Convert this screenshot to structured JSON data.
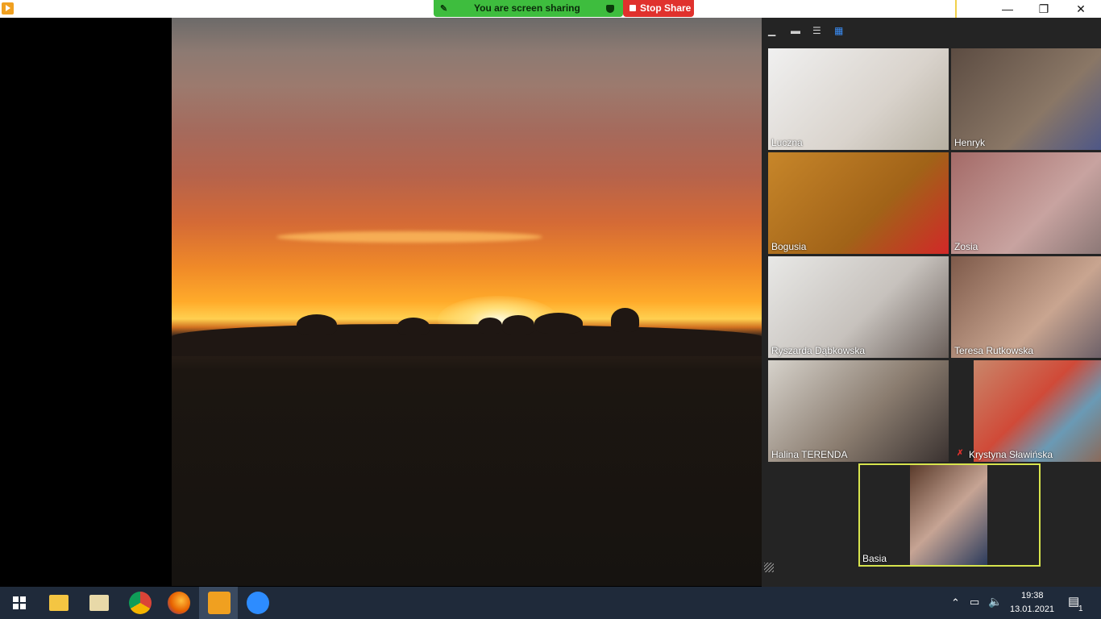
{
  "share_toolbar": {
    "status_text": "You are screen sharing",
    "stop_label": "Stop Share"
  },
  "window": {
    "minimize": "—",
    "maximize": "❐",
    "close": "✕"
  },
  "gallery": {
    "view_controls": [
      "minimize-view",
      "speaker-view",
      "gallery-strip",
      "gallery-view"
    ],
    "participants": [
      {
        "name": "Luczna"
      },
      {
        "name": "Henryk"
      },
      {
        "name": "Bogusia"
      },
      {
        "name": "Zosia"
      },
      {
        "name": "Ryszarda Dąbkowska"
      },
      {
        "name": "Teresa Rutkowska"
      },
      {
        "name": "Halina TERENDA"
      },
      {
        "name": "Krystyna Sławińska",
        "muted": true
      },
      {
        "name": "Basia",
        "active_speaker": true
      }
    ]
  },
  "taskbar": {
    "apps": [
      "windows-start",
      "file-explorer",
      "mail",
      "chrome",
      "firefox",
      "zoom-share",
      "zoom"
    ],
    "time": "19:38",
    "date": "13.01.2021",
    "notification_count": "1"
  }
}
